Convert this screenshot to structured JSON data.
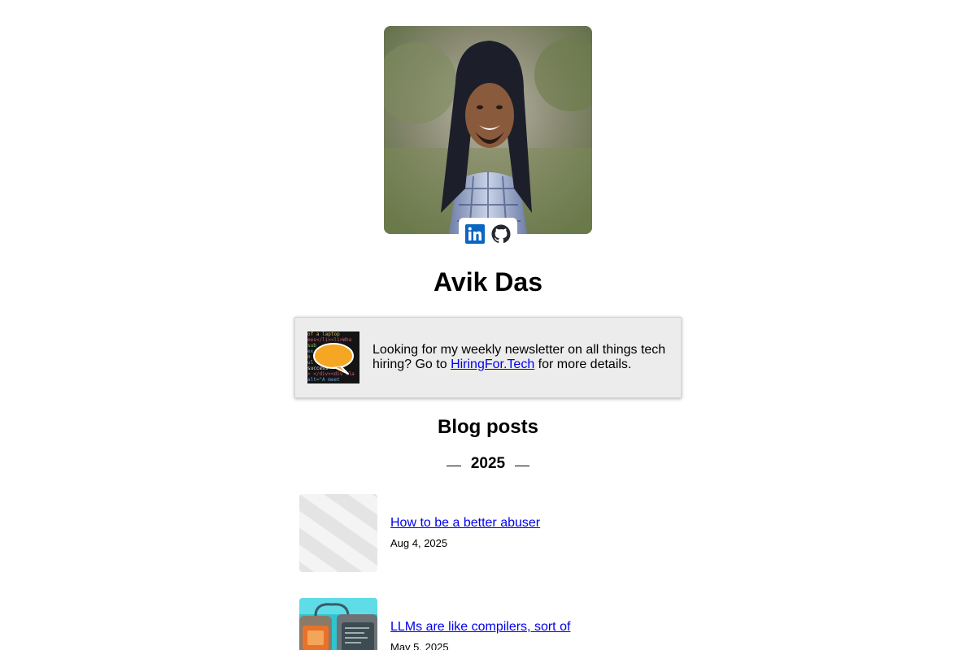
{
  "profile": {
    "name": "Avik Das",
    "photo_alt": "Avik Das",
    "social": [
      {
        "name": "LinkedIn",
        "icon": "linkedin-icon",
        "color": "#0a66c2"
      },
      {
        "name": "GitHub",
        "icon": "github-icon",
        "color": "#24292f"
      }
    ]
  },
  "newsletter": {
    "text_before": "Looking for my weekly newsletter on all things tech hiring? Go to ",
    "link_text": "HiringFor.Tech",
    "text_after": " for more details.",
    "bubble_color": "#f5a623"
  },
  "blog": {
    "title": "Blog posts",
    "year": "2025",
    "posts": [
      {
        "title": "How to be a better abuser",
        "date": "Aug 4, 2025",
        "thumb": "placeholder-stripes"
      },
      {
        "title": "LLMs are like compilers, sort of",
        "date": "May 5, 2025",
        "thumb": "teal-machines"
      }
    ]
  },
  "colors": {
    "link": "#0000ee",
    "newsletter_bg": "#ececec"
  }
}
